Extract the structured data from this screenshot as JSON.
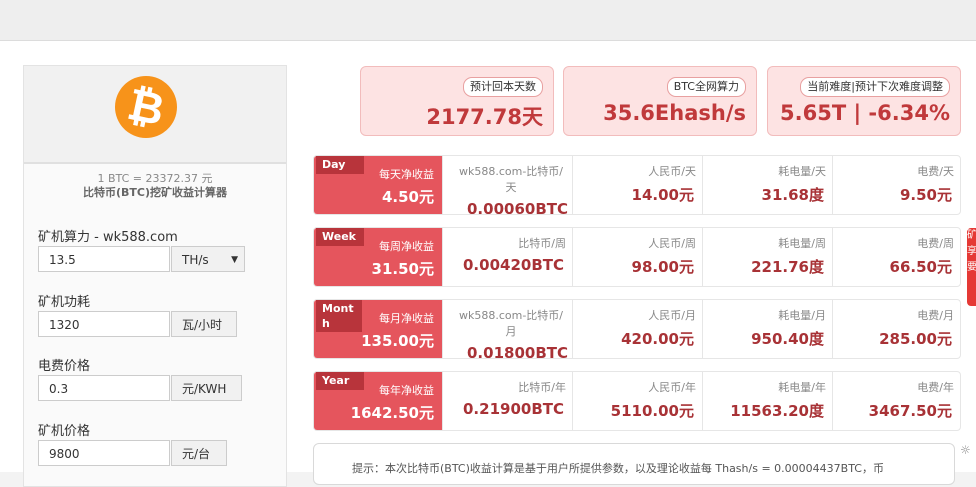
{
  "left_panel": {
    "logo_symbol": "₿",
    "price_text": "1 BTC = 23372.37 元",
    "calculator_title": "比特币(BTC)挖矿收益计算器",
    "fields": [
      {
        "label": "矿机算力 - wk588.com",
        "value": "13.5",
        "unit": "TH/s",
        "unit_is_select": true
      },
      {
        "label": "矿机功耗",
        "value": "1320",
        "unit": "瓦/小时"
      },
      {
        "label": "电费价格",
        "value": "0.3",
        "unit": "元/KWH"
      },
      {
        "label": "矿机价格",
        "value": "9800",
        "unit": "元/台"
      }
    ]
  },
  "summary": [
    {
      "tag": "预计回本天数",
      "value": "2177.78天"
    },
    {
      "tag": "BTC全网算力",
      "value": "35.6Ehash/s"
    },
    {
      "tag": "当前难度|预计下次难度调整",
      "value": "5.65T | -6.34%"
    }
  ],
  "rows": [
    {
      "badge": "Day",
      "net_label": "每天净收益",
      "net_value": "4.50元",
      "btc_label": "wk588.com-比特币/天",
      "btc_value": "0.00060BTC",
      "rmb_label": "人民币/天",
      "rmb_value": "14.00元",
      "power_label": "耗电量/天",
      "power_value": "31.68度",
      "fee_label": "电费/天",
      "fee_value": "9.50元"
    },
    {
      "badge": "Week",
      "net_label": "每周净收益",
      "net_value": "31.50元",
      "btc_label": "比特币/周",
      "btc_value": "0.00420BTC",
      "rmb_label": "人民币/周",
      "rmb_value": "98.00元",
      "power_label": "耗电量/周",
      "power_value": "221.76度",
      "fee_label": "电费/周",
      "fee_value": "66.50元"
    },
    {
      "badge": "Month",
      "net_label": "每月净收益",
      "net_value": "135.00元",
      "btc_label": "wk588.com-比特币/月",
      "btc_value": "0.01800BTC",
      "rmb_label": "人民币/月",
      "rmb_value": "420.00元",
      "power_label": "耗电量/月",
      "power_value": "950.40度",
      "fee_label": "电费/月",
      "fee_value": "285.00元"
    },
    {
      "badge": "Year",
      "net_label": "每年净收益",
      "net_value": "1642.50元",
      "btc_label": "比特币/年",
      "btc_value": "0.21900BTC",
      "rmb_label": "人民币/年",
      "rmb_value": "5110.00元",
      "power_label": "耗电量/年",
      "power_value": "11563.20度",
      "fee_label": "电费/年",
      "fee_value": "3467.50元"
    }
  ],
  "note": "提示：本次比特币(BTC)收益计算是基于用户所提供参数，以及理论收益每 Thash/s = 0.00004437BTC，币",
  "side_tab": [
    "矿",
    "享",
    "要"
  ],
  "colors": {
    "accent": "#e5555d",
    "badge": "#b8343b",
    "value": "#a83236",
    "btc_orange": "#f7931a"
  }
}
